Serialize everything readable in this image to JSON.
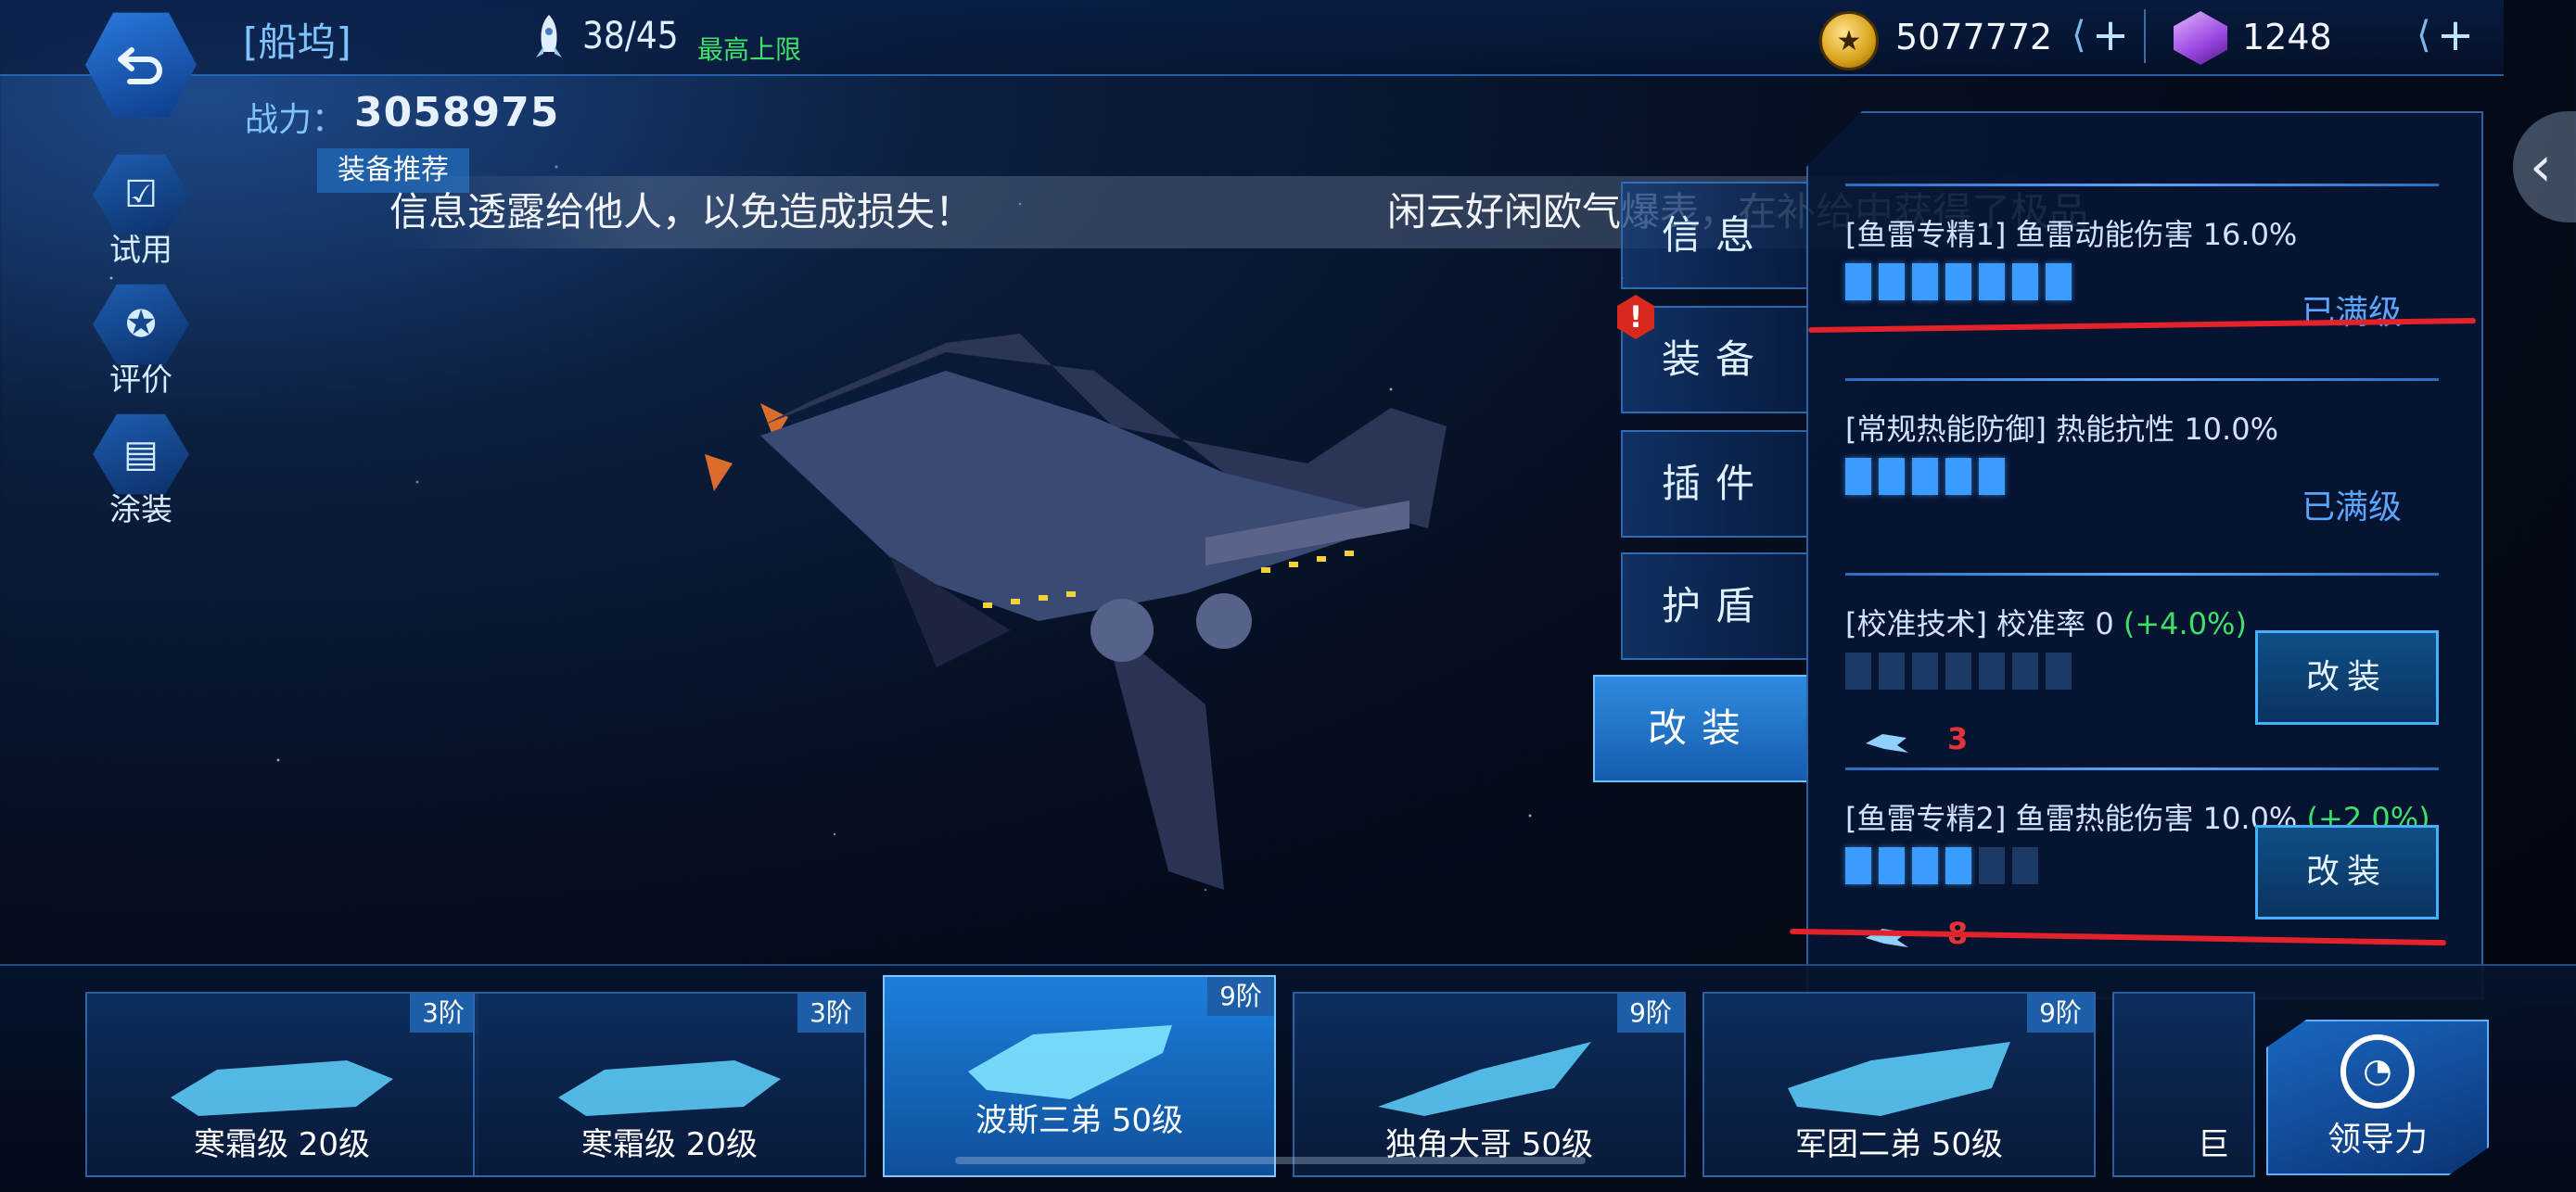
{
  "header": {
    "title": "[船坞]",
    "ship_count": "38/45",
    "ship_limit_label": "最高上限",
    "coins": "5077772",
    "gems": "1248",
    "plus_label": "+"
  },
  "power": {
    "label": "战力：",
    "value": "3058975"
  },
  "equip_recommend_label": "装备推荐",
  "side_menu": [
    {
      "label": "试用",
      "icon": "checkbox-icon"
    },
    {
      "label": "评价",
      "icon": "star-badge-icon"
    },
    {
      "label": "涂装",
      "icon": "spray-can-icon"
    }
  ],
  "marquee": {
    "text1": "信息透露给他人，以免造成损失！",
    "text2": "闲云好闲欧气爆表，在补给中获得了极品"
  },
  "tabs": [
    {
      "label": "信息"
    },
    {
      "label": "装备"
    },
    {
      "label": "插件"
    },
    {
      "label": "护盾"
    },
    {
      "label": "改装"
    }
  ],
  "alert_badge": "!",
  "mods": [
    {
      "title": "[鱼雷专精1] 鱼雷动能伤害 16.0%",
      "bonus": "",
      "filled": 7,
      "total": 7,
      "status": "已满级"
    },
    {
      "title": "[常规热能防御] 热能抗性 10.0%",
      "bonus": "",
      "filled": 5,
      "total": 5,
      "status": "已满级"
    },
    {
      "title": "[校准技术] 校准率 0 ",
      "bonus": "(+4.0%)",
      "filled": 0,
      "total": 7,
      "button": "改装",
      "material_count": "3"
    },
    {
      "title": "[鱼雷专精2] 鱼雷热能伤害 10.0% ",
      "bonus": "(+2.0%)",
      "filled": 4,
      "total": 6,
      "button": "改装",
      "material_count": "8"
    }
  ],
  "ships": [
    {
      "name": "寒霜级 20级",
      "tier": "3阶"
    },
    {
      "name": "寒霜级 20级",
      "tier": "3阶"
    },
    {
      "name": "波斯三弟 50级",
      "tier": "9阶",
      "selected": true
    },
    {
      "name": "独角大哥 50级",
      "tier": "9阶"
    },
    {
      "name": "军团二弟 50级",
      "tier": "9阶"
    },
    {
      "name": "巨",
      "tier": ""
    }
  ],
  "nav_button_label": "领导力",
  "colors": {
    "accent": "#2f8be0",
    "green": "#3ee06a",
    "red": "#e0333a",
    "maxed": "#5aa6ff"
  }
}
